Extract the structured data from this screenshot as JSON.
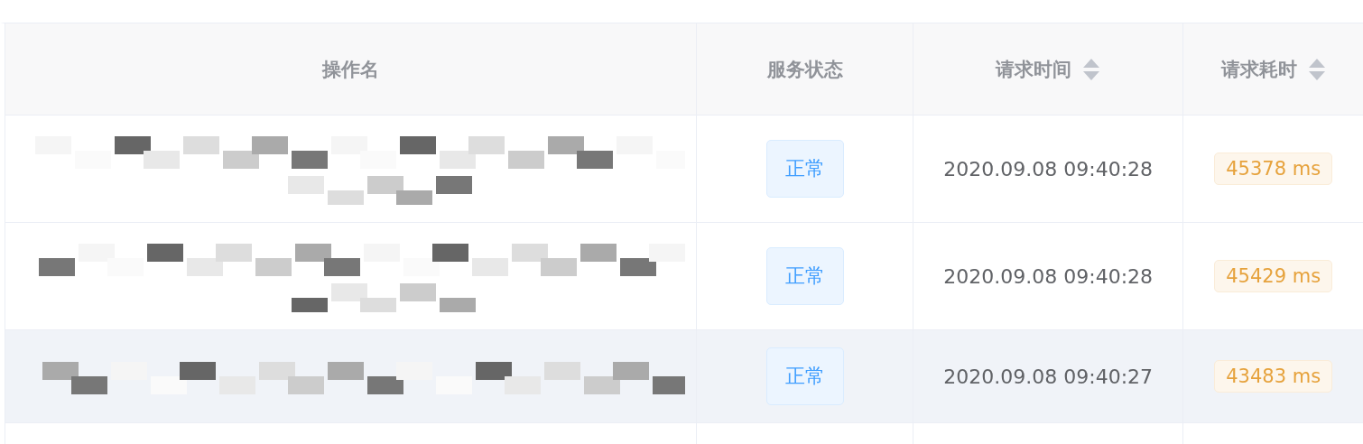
{
  "table": {
    "columns": [
      {
        "label": "操作名",
        "sortable": false
      },
      {
        "label": "服务状态",
        "sortable": false
      },
      {
        "label": "请求时间",
        "sortable": true
      },
      {
        "label": "请求耗时",
        "sortable": true
      }
    ],
    "rows": [
      {
        "status": "正常",
        "time": "2020.09.08 09:40:28",
        "duration": "45378 ms",
        "hovered": false
      },
      {
        "status": "正常",
        "time": "2020.09.08 09:40:28",
        "duration": "45429 ms",
        "hovered": false
      },
      {
        "status": "正常",
        "time": "2020.09.08 09:40:27",
        "duration": "43483 ms",
        "hovered": true
      }
    ]
  }
}
